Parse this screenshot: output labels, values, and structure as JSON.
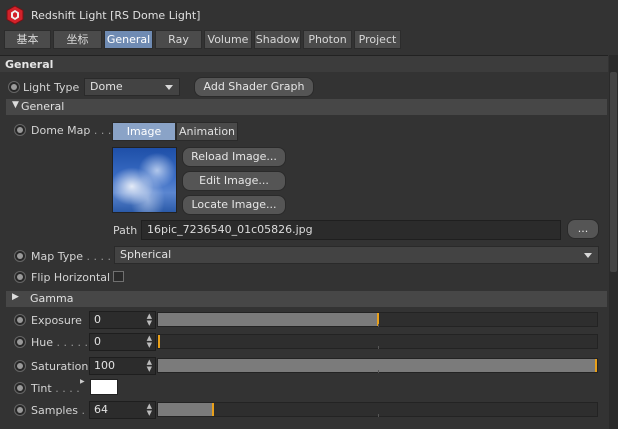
{
  "window": {
    "title": "Redshift Light [RS Dome Light]"
  },
  "tabs": [
    {
      "label": "基本",
      "active": false
    },
    {
      "label": "坐标",
      "active": false
    },
    {
      "label": "General",
      "active": true
    },
    {
      "label": "Ray",
      "active": false
    },
    {
      "label": "Volume",
      "active": false
    },
    {
      "label": "Shadow",
      "active": false
    },
    {
      "label": "Photon",
      "active": false
    },
    {
      "label": "Project",
      "active": false
    }
  ],
  "section_title": "General",
  "light_type": {
    "label": "Light Type",
    "value": "Dome"
  },
  "add_shader_graph_label": "Add Shader Graph",
  "subsection_general": "General",
  "dome_map": {
    "label": "Dome Map",
    "dots": ". . .",
    "mode_tabs": [
      {
        "label": "Image",
        "active": true
      },
      {
        "label": "Animation",
        "active": false
      }
    ],
    "reload_label": "Reload Image...",
    "edit_label": "Edit Image...",
    "locate_label": "Locate Image...",
    "path_label": "Path",
    "path_value": "16pic_7236540_01c05826.jpg",
    "browse_label": "..."
  },
  "map_type": {
    "label": "Map Type",
    "dots": ". . . .",
    "value": "Spherical"
  },
  "flip_horizontal": {
    "label": "Flip Horizontal",
    "checked": false
  },
  "gamma_section": "Gamma",
  "fields": {
    "exposure": {
      "label": "Exposure",
      "dots": "",
      "value": "0",
      "fraction": 0.5
    },
    "hue": {
      "label": "Hue",
      "dots": ". . . . .",
      "value": "0",
      "fraction": 0.0
    },
    "saturation": {
      "label": "Saturation",
      "dots": "",
      "value": "100",
      "fraction": 1.0
    },
    "tint": {
      "label": "Tint",
      "dots": ". . . .",
      "color": "#ffffff"
    },
    "samples": {
      "label": "Samples",
      "dots": ". .",
      "value": "64",
      "fraction": 0.125
    }
  },
  "colors": {
    "accent": "#6f8bb3",
    "slider_marker": "#e9a01a",
    "logo": "#d3222a"
  }
}
